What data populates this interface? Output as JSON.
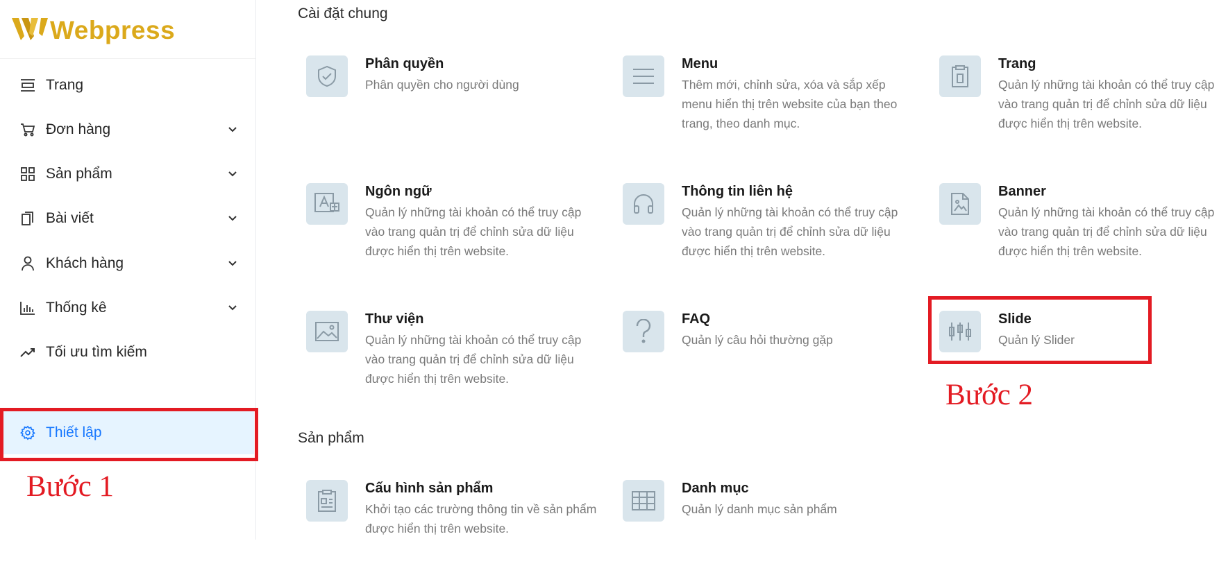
{
  "app": {
    "logo_text": "Webpress",
    "brand_color": "#dba91b",
    "accent_color": "#1677ff",
    "annotation_color": "#e31b23"
  },
  "sidebar": {
    "items": [
      {
        "label": "Trang",
        "icon": "page-layout-icon",
        "has_chevron": false
      },
      {
        "label": "Đơn hàng",
        "icon": "shopping-cart-icon",
        "has_chevron": true
      },
      {
        "label": "Sản phẩm",
        "icon": "grid-icon",
        "has_chevron": true
      },
      {
        "label": "Bài viết",
        "icon": "documents-icon",
        "has_chevron": true
      },
      {
        "label": "Khách hàng",
        "icon": "user-icon",
        "has_chevron": true
      },
      {
        "label": "Thống kê",
        "icon": "bar-chart-icon",
        "has_chevron": true
      },
      {
        "label": "Tối ưu tìm kiếm",
        "icon": "trend-line-icon",
        "has_chevron": false
      },
      {
        "label": "Thiết lập",
        "icon": "gear-icon",
        "has_chevron": false,
        "active": true
      }
    ]
  },
  "annotations": {
    "step1": "Bước 1",
    "step2": "Bước 2"
  },
  "main": {
    "sections": [
      {
        "title": "Cài đặt chung",
        "cards": [
          {
            "title": "Phân quyền",
            "desc": "Phân quyền cho người dùng",
            "icon": "shield-check-icon"
          },
          {
            "title": "Menu",
            "desc": "Thêm mới, chỉnh sửa, xóa và sắp xếp menu hiển thị trên website của bạn theo trang, theo danh mục.",
            "icon": "menu-lines-icon"
          },
          {
            "title": "Trang",
            "desc": "Quản lý những tài khoản có thể truy cập vào trang quản trị để chỉnh sửa dữ liệu được hiển thị trên website.",
            "icon": "clipboard-page-icon"
          },
          {
            "title": "Ngôn ngữ",
            "desc": "Quản lý những tài khoản có thể truy cập vào trang quản trị để chỉnh sửa dữ liệu được hiển thị trên website.",
            "icon": "translate-icon"
          },
          {
            "title": "Thông tin liên hệ",
            "desc": "Quản lý những tài khoản có thể truy cập vào trang quản trị để chỉnh sửa dữ liệu được hiển thị trên website.",
            "icon": "headphones-icon"
          },
          {
            "title": "Banner",
            "desc": "Quản lý những tài khoản có thể truy cập vào trang quản trị để chỉnh sửa dữ liệu được hiển thị trên website.",
            "icon": "file-image-icon"
          },
          {
            "title": "Thư viện",
            "desc": "Quản lý những tài khoản có thể truy cập vào trang quản trị để chỉnh sửa dữ liệu được hiển thị trên website.",
            "icon": "image-icon"
          },
          {
            "title": "FAQ",
            "desc": "Quản lý câu hỏi thường gặp",
            "icon": "question-icon"
          },
          {
            "title": "Slide",
            "desc": "Quản lý Slider",
            "icon": "sliders-icon"
          }
        ]
      },
      {
        "title": "Sản phẩm",
        "cards": [
          {
            "title": "Cấu hình sản phẩm",
            "desc": "Khởi tạo các trường thông tin về sản phẩm được hiển thị trên website.",
            "icon": "product-config-icon"
          },
          {
            "title": "Danh mục",
            "desc": "Quản lý danh mục sản phẩm",
            "icon": "table-icon"
          }
        ]
      }
    ]
  }
}
